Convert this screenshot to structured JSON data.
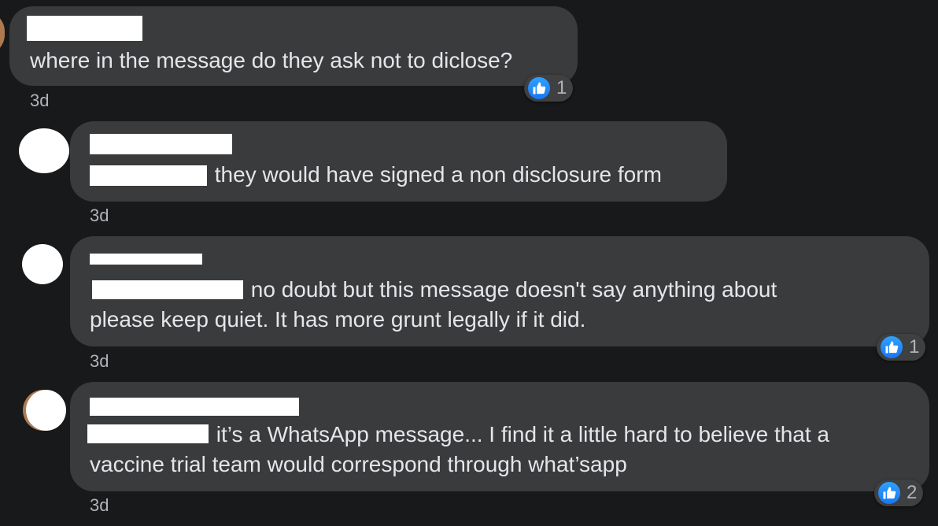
{
  "comments": [
    {
      "text": "where in the message do they ask not to diclose?",
      "time": "3d",
      "reactions": {
        "icon": "like-icon",
        "count": "1"
      }
    },
    {
      "text": " they would have signed a non disclosure form",
      "time": "3d"
    },
    {
      "text_line1": " no doubt but this message doesn't say anything about",
      "text_line2": "please keep quiet. It has more grunt legally if it did.",
      "time": "3d",
      "reactions": {
        "icon": "like-icon",
        "count": "1"
      }
    },
    {
      "text_line1": " it’s a WhatsApp message... I find it a little hard to believe that a",
      "text_line2": "vaccine trial team would correspond through what’sapp",
      "time": "3d",
      "reactions": {
        "icon": "like-icon",
        "count": "2"
      }
    }
  ],
  "colors": {
    "background": "#18191a",
    "bubble": "#3a3b3c",
    "text": "#e4e6eb",
    "secondary_text": "#b0b3b8",
    "like_blue": "#1877f2",
    "redaction": "#ffffff"
  }
}
